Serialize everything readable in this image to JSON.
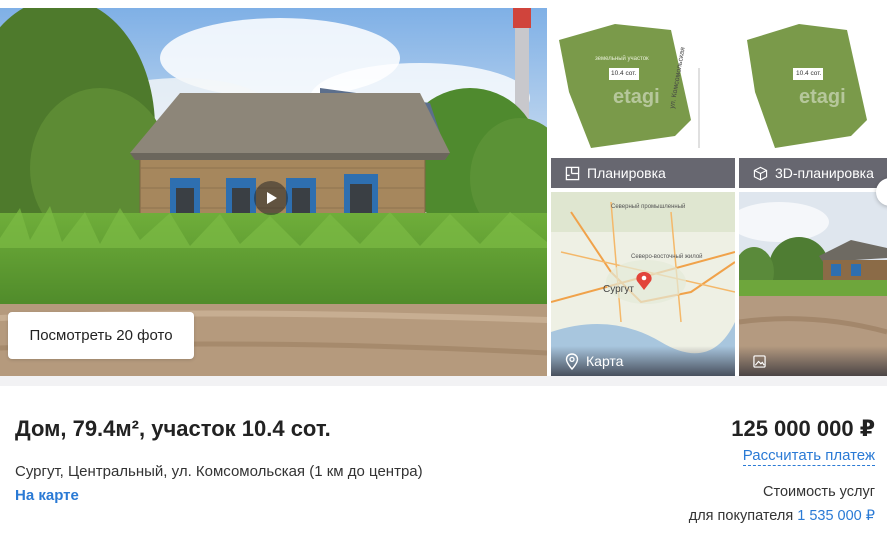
{
  "gallery": {
    "view_photos_label": "Посмотреть 20 фото",
    "plan_caption": "Планировка",
    "plan3d_caption": "3D-планировка",
    "map_caption": "Карта",
    "plan_area_label": "10.4 сот.",
    "plan_land_label": "земельный участок",
    "plan_street_label": "ул. Комсомольская",
    "watermark": "etagi",
    "map_city_label": "Сургут",
    "map_area_label_1": "Северный промышленный",
    "map_area_label_2": "Северо-восточный жилой"
  },
  "listing": {
    "title": "Дом, 79.4м², участок 10.4 сот.",
    "address": "Сургут, Центральный, ул. Комсомольская (1 км до центра)",
    "map_link": "На карте",
    "price": "125 000 000 ₽",
    "calc_payment": "Рассчитать платеж",
    "service_cost_label": "Стоимость услуг",
    "service_buyer_label": "для покупателя",
    "service_buyer_amount": "1 535 000 ₽"
  },
  "icons": {
    "video": "play-icon",
    "plan": "floorplan-icon",
    "plan3d": "cube-icon",
    "map": "map-pin-icon",
    "photo": "image-icon"
  },
  "colors": {
    "link": "#2a7ad5",
    "plan_land": "#7a9a4a",
    "caption_bg": "#464650"
  }
}
